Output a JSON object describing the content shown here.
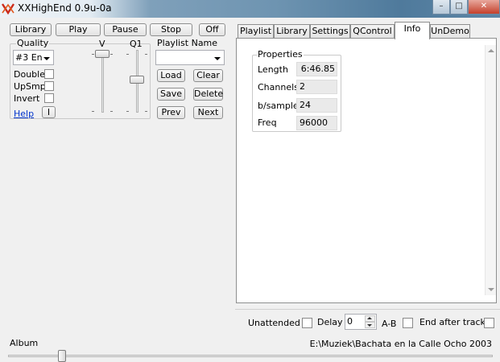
{
  "window": {
    "title": "XXHighEnd 0.9u-0a",
    "controls": {
      "minimize": "–",
      "maximize": "□",
      "close": "✕"
    }
  },
  "toolbar": {
    "library": "Library",
    "play": "Play",
    "pause": "Pause",
    "stop": "Stop",
    "off": "Off"
  },
  "quality": {
    "label": "Quality",
    "selected": "#3 En",
    "double": "Double",
    "upsmp": "UpSmp",
    "invert": "Invert",
    "help": "Help",
    "info_button": "I",
    "v_label": "V",
    "q1_label": "Q1"
  },
  "playlist_name": {
    "label": "Playlist Name",
    "value": "",
    "load": "Load",
    "clear": "Clear",
    "save": "Save",
    "delete": "Delete",
    "prev": "Prev",
    "next": "Next"
  },
  "tabs": [
    "Playlist",
    "Library",
    "Settings",
    "QControl",
    "Info",
    "UnDemo"
  ],
  "active_tab": "Info",
  "properties": {
    "title": "Properties",
    "rows": [
      {
        "label": "Length",
        "value": "6:46.85"
      },
      {
        "label": "Channels",
        "value": "2"
      },
      {
        "label": "b/sample",
        "value": "24"
      },
      {
        "label": "Freq",
        "value": "96000"
      }
    ]
  },
  "bottom": {
    "unattended": "Unattended",
    "delay": "Delay",
    "delay_value": "0",
    "ab": "A-B",
    "end_after_track": "End after track"
  },
  "status": {
    "album_label": "Album",
    "path": "E:\\Muziek\\Bachata en la Calle Ocho 2003"
  },
  "colors": {
    "help_link": "#0033cc",
    "titlebar_accent": "#6e94b1"
  }
}
